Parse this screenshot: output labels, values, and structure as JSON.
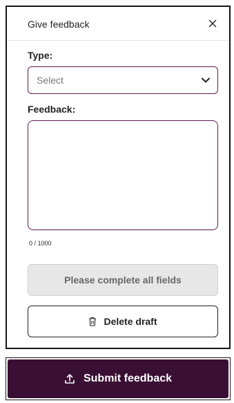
{
  "dialog": {
    "title": "Give feedback",
    "type_label": "Type:",
    "type_placeholder": "Select",
    "feedback_label": "Feedback:",
    "feedback_value": "",
    "char_counter": "0 / 1000",
    "disabled_button_label": "Please complete all fields",
    "delete_button_label": "Delete draft"
  },
  "footer": {
    "submit_label": "Submit feedback"
  },
  "colors": {
    "accent": "#3a0f34",
    "border_accent": "#5b1b4d",
    "disabled_bg": "#e7e7e7"
  },
  "icons": {
    "close": "close-icon",
    "chevron": "chevron-down-icon",
    "delete": "trash-icon",
    "submit": "upload-icon"
  }
}
